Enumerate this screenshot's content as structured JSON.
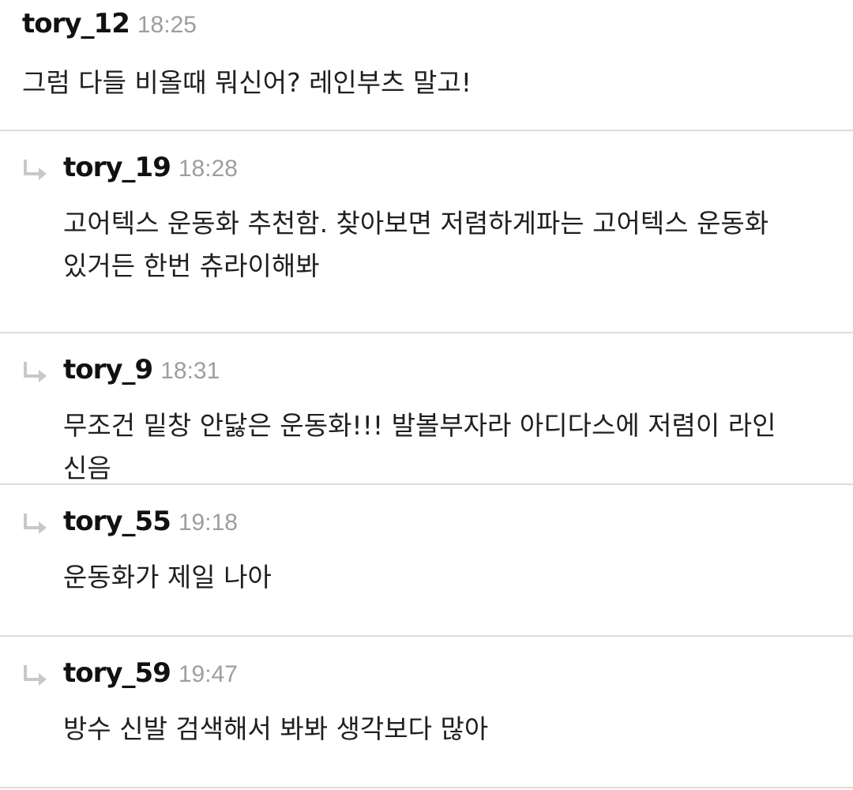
{
  "comments": [
    {
      "username": "tory_12",
      "time": "18:25",
      "text": "그럼 다들 비올때 뭐신어? 레인부츠 말고!"
    },
    {
      "username": "tory_19",
      "time": "18:28",
      "text": "고어텍스 운동화 추천함. 찾아보면 저렴하게파는 고어텍스 운동화 있거든 한번 츄라이해봐",
      "icon": "reply-arrow-icon"
    },
    {
      "username": "tory_9",
      "time": "18:31",
      "text": "무조건 밑창 안닳은 운동화!!! 발볼부자라 아디다스에 저렴이 라인 신음",
      "icon": "reply-arrow-icon"
    },
    {
      "username": "tory_55",
      "time": "19:18",
      "text": "운동화가 제일 나아",
      "icon": "reply-arrow-icon"
    },
    {
      "username": "tory_59",
      "time": "19:47",
      "text": "방수 신발 검색해서 봐봐 생각보다 많아",
      "icon": "reply-arrow-icon"
    }
  ],
  "colors": {
    "divider": "#dcdcdc",
    "time": "#9e9e9e",
    "reply_arrow": "#c8c8c8"
  }
}
